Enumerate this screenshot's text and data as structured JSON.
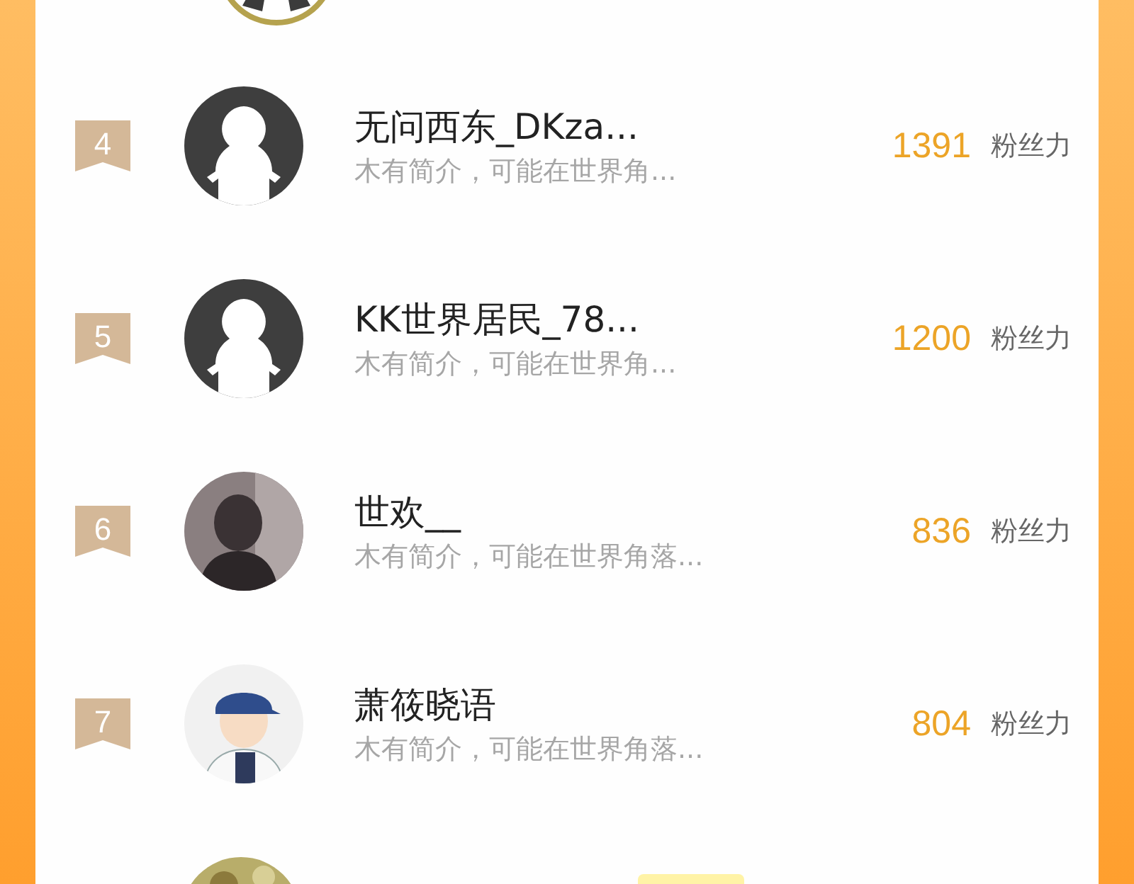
{
  "rows": [
    {
      "rank": "4",
      "name": "无问西东_DKza...",
      "bio": "木有简介，可能在世界角...",
      "fans": "1391",
      "fans_label": "粉丝力",
      "avatar": {
        "kind": "default"
      }
    },
    {
      "rank": "5",
      "name": "KK世界居民_78...",
      "bio": "木有简介，可能在世界角...",
      "fans": "1200",
      "fans_label": "粉丝力",
      "avatar": {
        "kind": "default"
      }
    },
    {
      "rank": "6",
      "name": "世欢__",
      "bio": "木有简介，可能在世界角落...",
      "fans": "836",
      "fans_label": "粉丝力"
    },
    {
      "rank": "7",
      "name": "萧筱晓语",
      "bio": "木有简介，可能在世界角落...",
      "fans": "804",
      "fans_label": "粉丝力",
      "avatar": {
        "kind": "figure"
      }
    }
  ]
}
